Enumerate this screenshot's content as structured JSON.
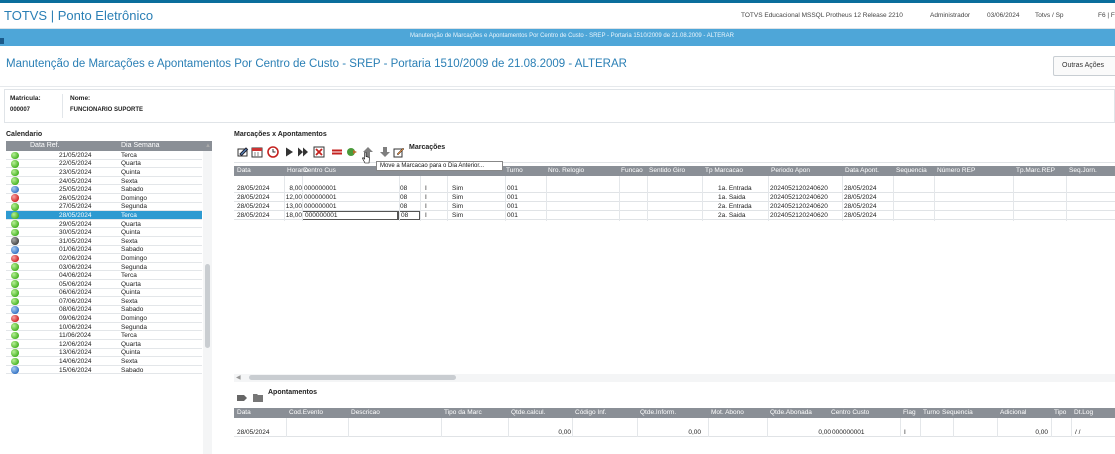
{
  "app": {
    "title": "TOTVS | Ponto Eletrônico"
  },
  "system": {
    "environment": "TOTVS Educacional MSSQL Protheus 12 Release 2210",
    "user": "Administrador",
    "date": "03/06/2024",
    "branch": "Totvs / Sp",
    "key": "F6 | F"
  },
  "window": {
    "title": "Manutenção de Marcações e Apontamentos Por Centro de Custo - SREP - Portaria 1510/2009 de 21.08.2009 - ALTERAR"
  },
  "page": {
    "heading": "Manutenção de Marcações e Apontamentos Por Centro de Custo - SREP - Portaria 1510/2009 de 21.08.2009 - ALTERAR",
    "other_actions_label": "Outras Ações"
  },
  "employee": {
    "matricula_label": "Matricula:",
    "matricula": "000007",
    "nome_label": "Nome:",
    "nome": "FUNCIONARIO SUPORTE"
  },
  "calendar": {
    "label": "Calendario",
    "columns": [
      "Data Ref.",
      "Dia Semana"
    ],
    "rows": [
      {
        "status": "green",
        "date": "21/05/2024",
        "day": "Terca"
      },
      {
        "status": "green",
        "date": "22/05/2024",
        "day": "Quarta"
      },
      {
        "status": "green",
        "date": "23/05/2024",
        "day": "Quinta"
      },
      {
        "status": "green",
        "date": "24/05/2024",
        "day": "Sexta"
      },
      {
        "status": "blue",
        "date": "25/05/2024",
        "day": "Sabado"
      },
      {
        "status": "red",
        "date": "26/05/2024",
        "day": "Domingo"
      },
      {
        "status": "green",
        "date": "27/05/2024",
        "day": "Segunda"
      },
      {
        "status": "green",
        "date": "28/05/2024",
        "day": "Terca",
        "selected": true
      },
      {
        "status": "green",
        "date": "29/05/2024",
        "day": "Quarta"
      },
      {
        "status": "green",
        "date": "30/05/2024",
        "day": "Quinta"
      },
      {
        "status": "black",
        "date": "31/05/2024",
        "day": "Sexta"
      },
      {
        "status": "blue",
        "date": "01/06/2024",
        "day": "Sabado"
      },
      {
        "status": "red",
        "date": "02/06/2024",
        "day": "Domingo"
      },
      {
        "status": "green",
        "date": "03/06/2024",
        "day": "Segunda"
      },
      {
        "status": "green",
        "date": "04/06/2024",
        "day": "Terca"
      },
      {
        "status": "green",
        "date": "05/06/2024",
        "day": "Quarta"
      },
      {
        "status": "green",
        "date": "06/06/2024",
        "day": "Quinta"
      },
      {
        "status": "green",
        "date": "07/06/2024",
        "day": "Sexta"
      },
      {
        "status": "blue",
        "date": "08/06/2024",
        "day": "Sabado"
      },
      {
        "status": "red",
        "date": "09/06/2024",
        "day": "Domingo"
      },
      {
        "status": "green",
        "date": "10/06/2024",
        "day": "Segunda"
      },
      {
        "status": "green",
        "date": "11/06/2024",
        "day": "Terca"
      },
      {
        "status": "green",
        "date": "12/06/2024",
        "day": "Quarta"
      },
      {
        "status": "green",
        "date": "13/06/2024",
        "day": "Quinta"
      },
      {
        "status": "green",
        "date": "14/06/2024",
        "day": "Sexta"
      },
      {
        "status": "blue",
        "date": "15/06/2024",
        "day": "Sabado"
      }
    ]
  },
  "marcacoes": {
    "label": "Marcações x Apontamentos",
    "toolbar_title": "Marcações",
    "tooltip": "Move a Marcacao para o Dia Anterior...",
    "columns": [
      "Data",
      "Horario",
      "Centro Cus",
      "",
      "",
      "",
      "Turno",
      "Nro. Relogio",
      "Funcao",
      "Sentido Giro",
      "Tp Marcacao",
      "Periodo Apon",
      "Data Apont.",
      "Sequencia",
      "Número REP",
      "Tp.Marc.REP",
      "Seq.Jorn."
    ],
    "rows": [
      {
        "data": "28/05/2024",
        "horario": "8,00",
        "cc": "000000001",
        "c1": "08",
        "c2": "I",
        "c3": "Sim",
        "turno": "001",
        "tp": "1a. Entrada",
        "periodo": "2024052120240620",
        "dapont": "28/05/2024"
      },
      {
        "data": "28/05/2024",
        "horario": "12,00",
        "cc": "000000001",
        "c1": "08",
        "c2": "I",
        "c3": "Sim",
        "turno": "001",
        "tp": "1a. Saida",
        "periodo": "2024052120240620",
        "dapont": "28/05/2024"
      },
      {
        "data": "28/05/2024",
        "horario": "13,00",
        "cc": "000000001",
        "c1": "08",
        "c2": "I",
        "c3": "Sim",
        "turno": "001",
        "tp": "2a. Entrada",
        "periodo": "2024052120240620",
        "dapont": "28/05/2024"
      },
      {
        "data": "28/05/2024",
        "horario": "18,00",
        "cc": "000000001",
        "c1": "08",
        "c2": "I",
        "c3": "Sim",
        "turno": "001",
        "tp": "2a. Saida",
        "periodo": "2024052120240620",
        "dapont": "28/05/2024"
      }
    ]
  },
  "apontamentos": {
    "label": "Apontamentos",
    "columns": [
      "Data",
      "Cod.Evento",
      "Descricao",
      "Tipo da Marc",
      "Qtde.calcul.",
      "Código Inf.",
      "Qtde.Inform.",
      "Mot. Abono",
      "Qtde.Abonada",
      "Centro Custo",
      "Flag",
      "Turno",
      "Sequencia",
      "Adicional",
      "Tipo",
      "Dt.Log"
    ],
    "row": {
      "data": "28/05/2024",
      "qcalc": "0,00",
      "qinf": "0,00",
      "qabon": "0,00",
      "cc": "000000001",
      "flag": "I",
      "adicional": "0,00",
      "dtlog": "/ /"
    }
  },
  "colors": {
    "accent": "#2a7fb5",
    "title_bar": "#4ea6d8",
    "grid_header": "#8a8f96",
    "selected_row": "#2d9ad1"
  }
}
